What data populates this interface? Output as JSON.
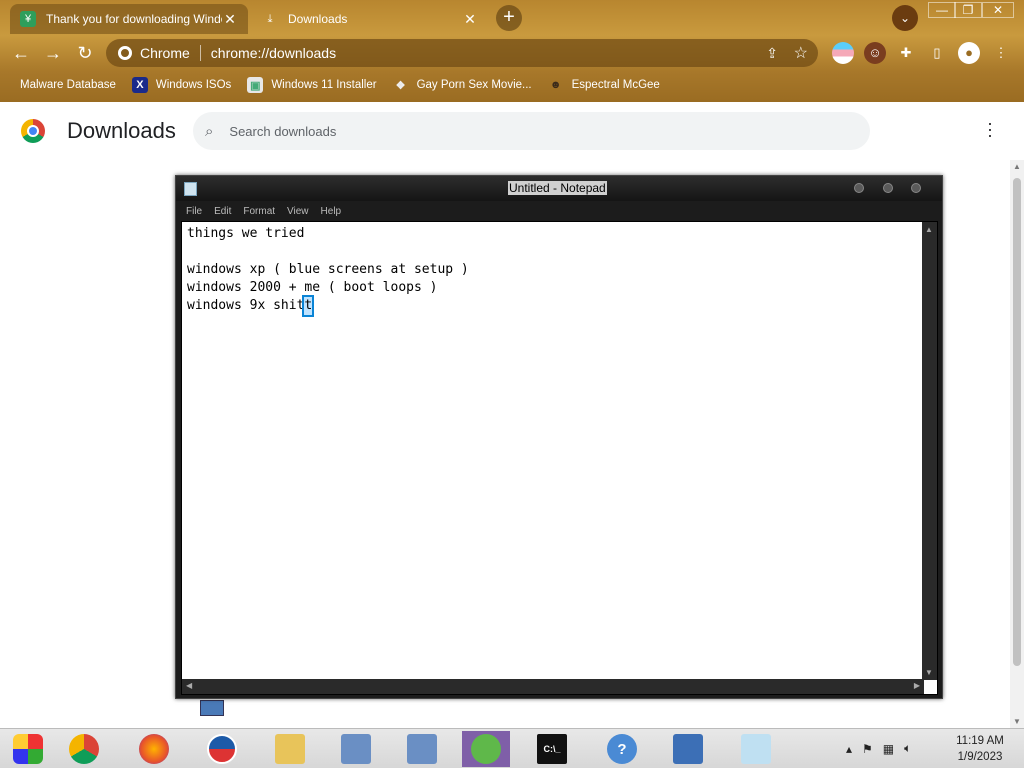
{
  "window_controls": {
    "minimize": "—",
    "maximize": "❐",
    "close": "✕"
  },
  "tabs": [
    {
      "title": "Thank you for downloading Windo",
      "icon": "download-app-icon",
      "active": true
    },
    {
      "title": "Downloads",
      "icon": "download-icon",
      "active": false
    }
  ],
  "toolbar": {
    "site_chip": "Chrome",
    "url": "chrome://downloads"
  },
  "bookmarks": [
    {
      "label": "Malware Database",
      "icon": "malware-icon"
    },
    {
      "label": "Windows ISOs",
      "icon": "x-icon"
    },
    {
      "label": "Windows 11 Installer",
      "icon": "image-icon"
    },
    {
      "label": "Gay Porn Sex Movie...",
      "icon": "dragon-icon"
    },
    {
      "label": "Espectral McGee",
      "icon": "ghost-icon"
    }
  ],
  "downloads_page": {
    "title": "Downloads",
    "search_placeholder": "Search downloads"
  },
  "notepad": {
    "title": "Untitled - Notepad",
    "menu": [
      "File",
      "Edit",
      "Format",
      "View",
      "Help"
    ],
    "lines": [
      "things we tried",
      "",
      "windows xp ( blue screens at setup )",
      "windows 2000 + me ( boot loops )"
    ],
    "last_line_prefix": "windows 9x shit",
    "last_line_caret_char": "t"
  },
  "taskbar": {
    "items": [
      "windows-media-center-icon",
      "chrome-icon",
      "firefox-icon",
      "obama-icon",
      "file-explorer-icon",
      "installer-icon",
      "installer-icon-2",
      "messenger-icon",
      "command-prompt-icon",
      "help-icon",
      "remote-desktop-icon",
      "notepad-icon"
    ],
    "time": "11:19 AM",
    "date": "1/9/2023"
  }
}
